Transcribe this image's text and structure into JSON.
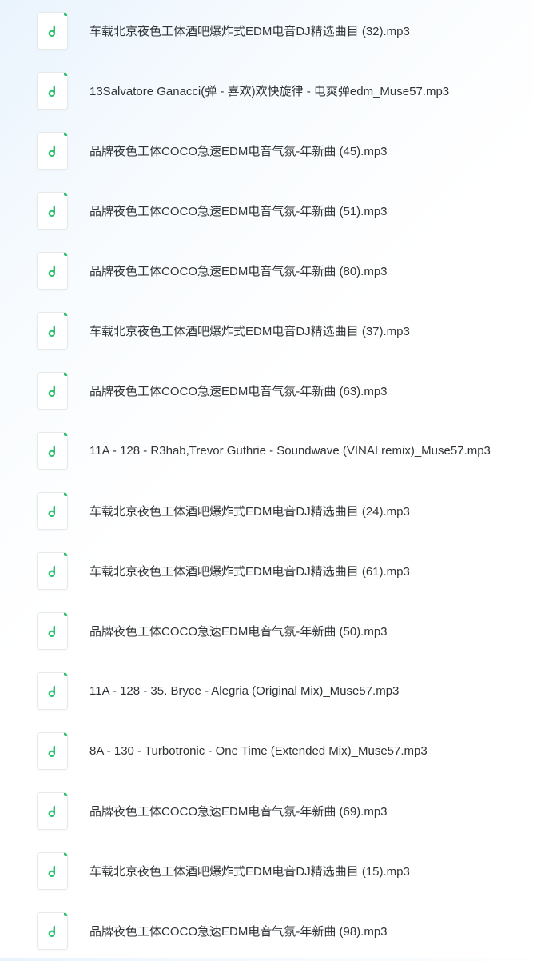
{
  "files": [
    {
      "name": "车载北京夜色工体酒吧爆炸式EDM电音DJ精选曲目 (32).mp3",
      "icon": "music-note-icon"
    },
    {
      "name": "13Salvatore Ganacci(弹 - 喜欢)欢快旋律 - 电爽弹edm_Muse57.mp3",
      "icon": "music-note-icon"
    },
    {
      "name": "品牌夜色工体COCO急速EDM电音气氛-年新曲 (45).mp3",
      "icon": "music-note-icon"
    },
    {
      "name": "品牌夜色工体COCO急速EDM电音气氛-年新曲 (51).mp3",
      "icon": "music-note-icon"
    },
    {
      "name": "品牌夜色工体COCO急速EDM电音气氛-年新曲 (80).mp3",
      "icon": "music-note-icon"
    },
    {
      "name": "车载北京夜色工体酒吧爆炸式EDM电音DJ精选曲目 (37).mp3",
      "icon": "music-note-icon"
    },
    {
      "name": "品牌夜色工体COCO急速EDM电音气氛-年新曲 (63).mp3",
      "icon": "music-note-icon"
    },
    {
      "name": "11A - 128 - R3hab,Trevor Guthrie - Soundwave (VINAI remix)_Muse57.mp3",
      "icon": "music-note-icon"
    },
    {
      "name": "车载北京夜色工体酒吧爆炸式EDM电音DJ精选曲目 (24).mp3",
      "icon": "music-note-icon"
    },
    {
      "name": "车载北京夜色工体酒吧爆炸式EDM电音DJ精选曲目 (61).mp3",
      "icon": "music-note-icon"
    },
    {
      "name": "品牌夜色工体COCO急速EDM电音气氛-年新曲 (50).mp3",
      "icon": "music-note-icon"
    },
    {
      "name": "11A - 128 - 35. Bryce - Alegria (Original Mix)_Muse57.mp3",
      "icon": "music-note-icon"
    },
    {
      "name": "8A - 130 - Turbotronic - One Time (Extended Mix)_Muse57.mp3",
      "icon": "music-note-icon"
    },
    {
      "name": "品牌夜色工体COCO急速EDM电音气氛-年新曲 (69).mp3",
      "icon": "music-note-icon"
    },
    {
      "name": "车载北京夜色工体酒吧爆炸式EDM电音DJ精选曲目 (15).mp3",
      "icon": "music-note-icon"
    },
    {
      "name": "品牌夜色工体COCO急速EDM电音气氛-年新曲 (98).mp3",
      "icon": "music-note-icon"
    }
  ],
  "colors": {
    "accent": "#2fbf71",
    "text": "#303437"
  }
}
